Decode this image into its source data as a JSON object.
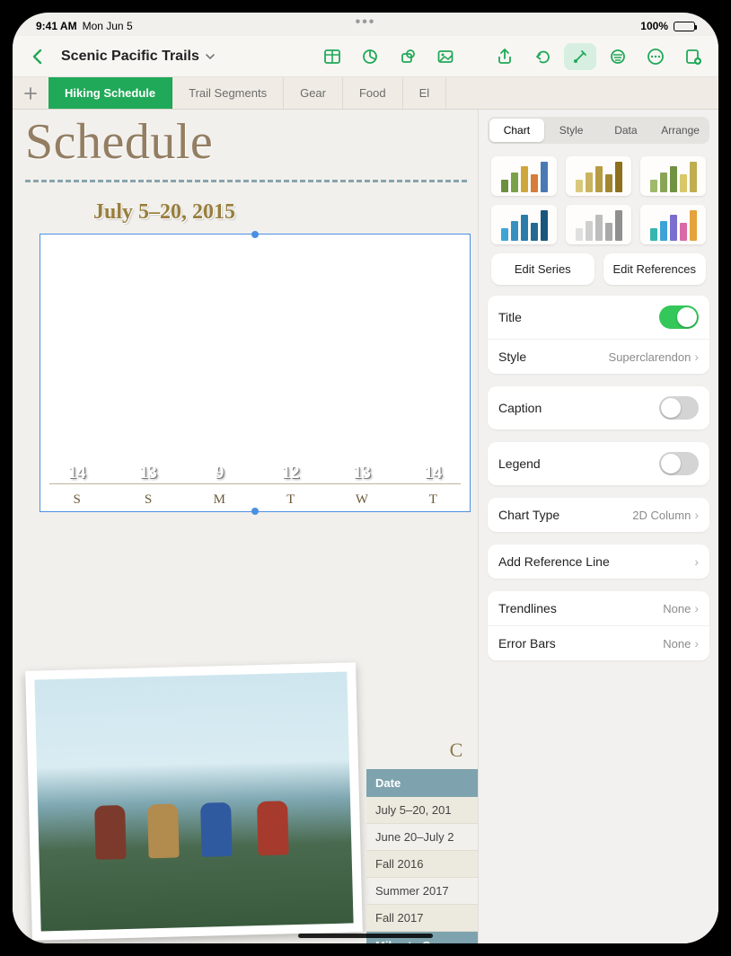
{
  "status": {
    "time": "9:41 AM",
    "date": "Mon Jun 5",
    "battery_pct": "100%"
  },
  "doc_title": "Scenic Pacific Trails",
  "sheet_tabs": [
    "Hiking Schedule",
    "Trail Segments",
    "Gear",
    "Food",
    "El"
  ],
  "active_sheet_index": 0,
  "big_heading": "Schedule",
  "chart_data": {
    "type": "bar",
    "title": "July 5–20, 2015",
    "categories": [
      "S",
      "S",
      "M",
      "T",
      "W",
      "T"
    ],
    "values": [
      14,
      13,
      9,
      12,
      13,
      14
    ],
    "ylim": [
      0,
      14
    ]
  },
  "mini_table": {
    "title_partial": "C",
    "header": "Date",
    "rows": [
      "July 5–20, 201",
      "June 20–July 2",
      "Fall 2016",
      "Summer 2017",
      "Fall 2017"
    ],
    "footer": "Miles to Com"
  },
  "panel": {
    "segments": [
      "Chart",
      "Style",
      "Data",
      "Arrange"
    ],
    "active_segment_index": 0,
    "edit_series": "Edit Series",
    "edit_refs": "Edit References",
    "rows": {
      "title_label": "Title",
      "title_on": true,
      "style_label": "Style",
      "style_value": "Superclarendon",
      "caption_label": "Caption",
      "caption_on": false,
      "legend_label": "Legend",
      "legend_on": false,
      "chart_type_label": "Chart Type",
      "chart_type_value": "2D Column",
      "add_ref_line": "Add Reference Line",
      "trendlines_label": "Trendlines",
      "trendlines_value": "None",
      "errorbars_label": "Error Bars",
      "errorbars_value": "None"
    }
  }
}
